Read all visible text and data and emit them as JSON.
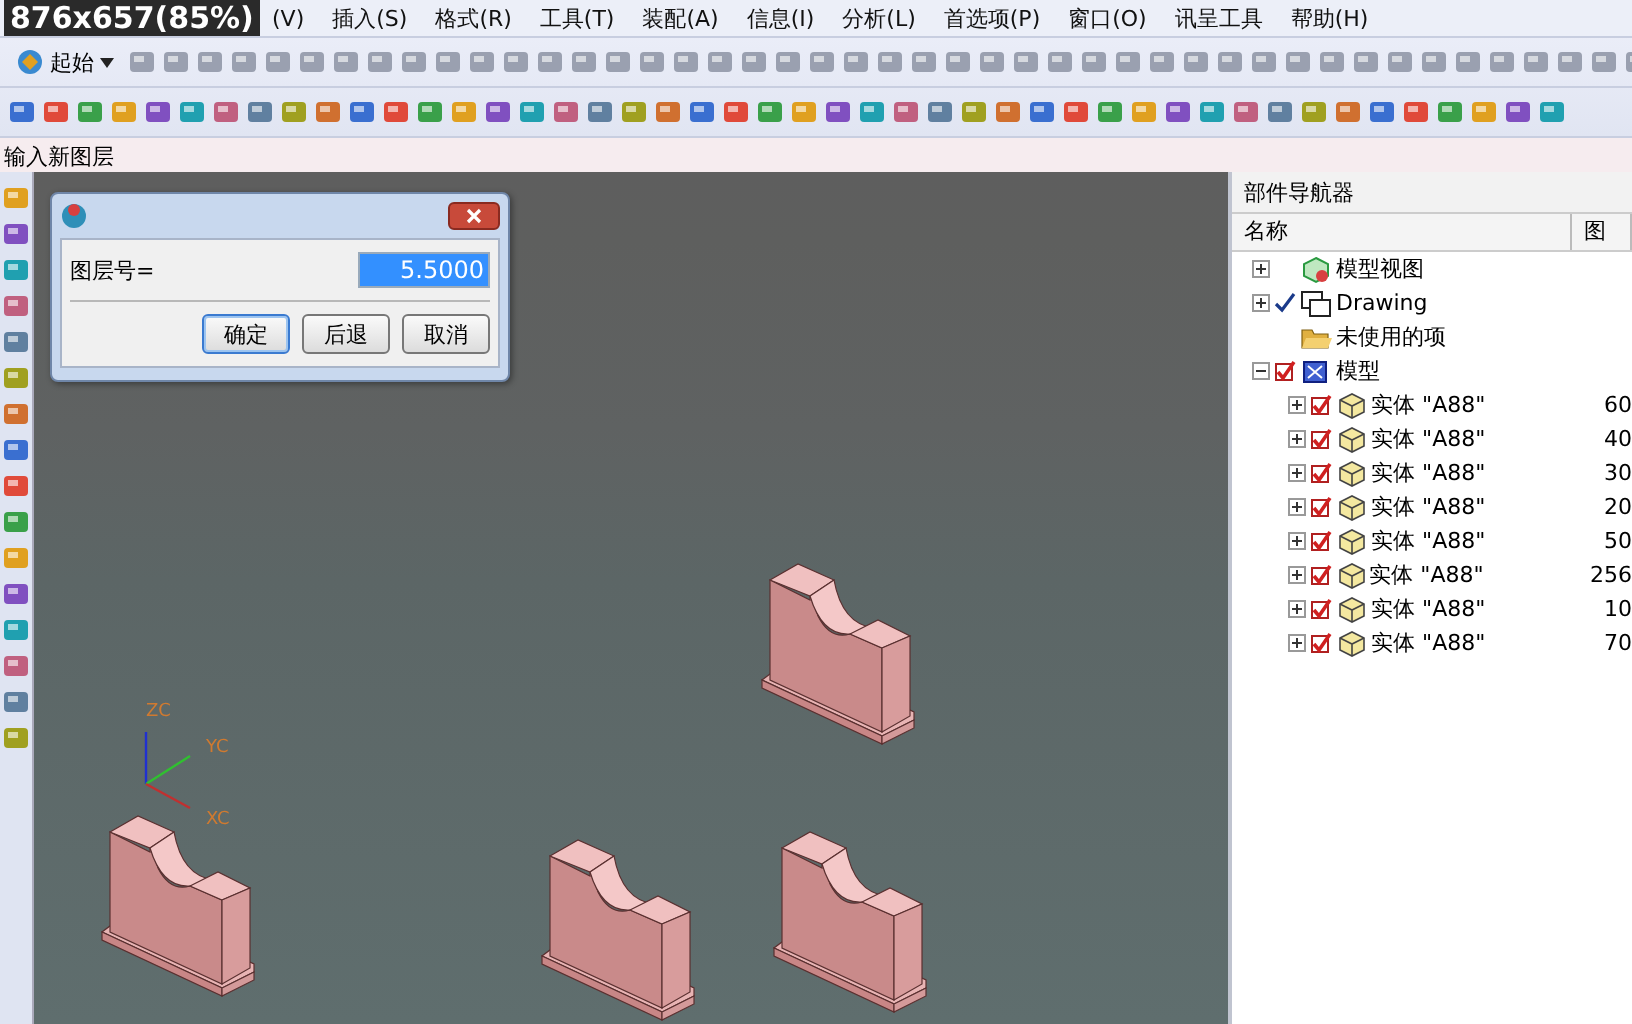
{
  "overlay_label": "876x657(85%)",
  "menu_bar": [
    "(V)",
    "插入(S)",
    "格式(R)",
    "工具(T)",
    "装配(A)",
    "信息(I)",
    "分析(L)",
    "首选项(P)",
    "窗口(O)",
    "讯呈工具",
    "帮助(H)"
  ],
  "start_button": "起始",
  "prompt": "输入新图层",
  "dialog": {
    "label": "图层号=",
    "value": "5.5000",
    "buttons": [
      {
        "label": "确定",
        "selected": true
      },
      {
        "label": "后退",
        "selected": false
      },
      {
        "label": "取消",
        "selected": false
      }
    ]
  },
  "viewport": {
    "axis_labels": [
      "ZC",
      "YC",
      "XC"
    ]
  },
  "navigator": {
    "title": "部件导航器",
    "columns": [
      "名称",
      "图"
    ],
    "tree": [
      {
        "label": "模型视图",
        "kind": "views",
        "expanded": false
      },
      {
        "label": "Drawing",
        "kind": "drawing",
        "expanded": false,
        "checked": true
      },
      {
        "label": "未使用的项",
        "kind": "folder"
      },
      {
        "label": "模型",
        "kind": "model",
        "expanded": true,
        "checked": true,
        "children": [
          {
            "label": "实体 \"A88\"",
            "kind": "body",
            "layer": "60",
            "expanded": false,
            "checked": true
          },
          {
            "label": "实体 \"A88\"",
            "kind": "body",
            "layer": "40",
            "expanded": false,
            "checked": true
          },
          {
            "label": "实体 \"A88\"",
            "kind": "body",
            "layer": "30",
            "expanded": false,
            "checked": true
          },
          {
            "label": "实体 \"A88\"",
            "kind": "body",
            "layer": "20",
            "expanded": false,
            "checked": true
          },
          {
            "label": "实体 \"A88\"",
            "kind": "body",
            "layer": "50",
            "expanded": false,
            "checked": true
          },
          {
            "label": "实体 \"A88\"",
            "kind": "body",
            "layer": "256",
            "expanded": false,
            "checked": true
          },
          {
            "label": "实体 \"A88\"",
            "kind": "body",
            "layer": "10",
            "expanded": false,
            "checked": true
          },
          {
            "label": "实体 \"A88\"",
            "kind": "body",
            "layer": "70",
            "expanded": false,
            "checked": true
          }
        ]
      }
    ]
  }
}
